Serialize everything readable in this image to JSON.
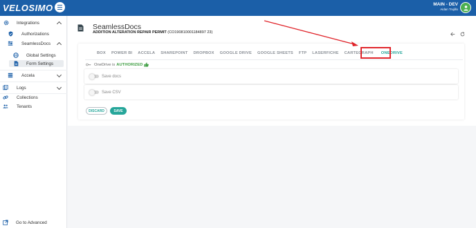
{
  "app": {
    "logo_text": "VELOSIMO",
    "env_title": "MAIN - DEV",
    "env_user": "Aidan Trujillo",
    "accent": "#1b5fa8",
    "teal": "#26a69a"
  },
  "sidebar": {
    "items": [
      {
        "label": "Integrations",
        "icon": "gear-icon",
        "expanded": true
      },
      {
        "label": "Authorizations",
        "icon": "shield-icon"
      },
      {
        "label": "SeamlessDocs",
        "icon": "sliders-icon",
        "expanded": true
      },
      {
        "label": "Global Settings",
        "icon": "globe-icon"
      },
      {
        "label": "Form Settings",
        "icon": "document-icon",
        "active": true
      },
      {
        "label": "Accela",
        "icon": "list-icon",
        "expanded": false
      },
      {
        "label": "Logs",
        "icon": "logs-icon",
        "expanded": false
      },
      {
        "label": "Collections",
        "icon": "link-icon"
      },
      {
        "label": "Tenants",
        "icon": "users-icon"
      }
    ],
    "advanced_label": "Go to Advanced"
  },
  "page": {
    "title": "SeamlessDocs",
    "subtitle": "ADDITION ALTERATION REPAIR PERMIT",
    "form_code": "(CO190810001184897 23)"
  },
  "tabs": [
    "BOX",
    "POWER BI",
    "ACCELA",
    "SHAREPOINT",
    "DROPBOX",
    "GOOGLE DRIVE",
    "GOOGLE SHEETS",
    "FTP",
    "LASERFICHE",
    "CARTEGRAPH",
    "ONEDRIVE"
  ],
  "active_tab": "ONEDRIVE",
  "auth": {
    "prefix": "OneDrive is",
    "status": "AUTHORIZED"
  },
  "options": {
    "save_docs": "Save docs",
    "save_csv": "Save CSV"
  },
  "buttons": {
    "discard": "DISCARD",
    "save": "SAVE"
  }
}
